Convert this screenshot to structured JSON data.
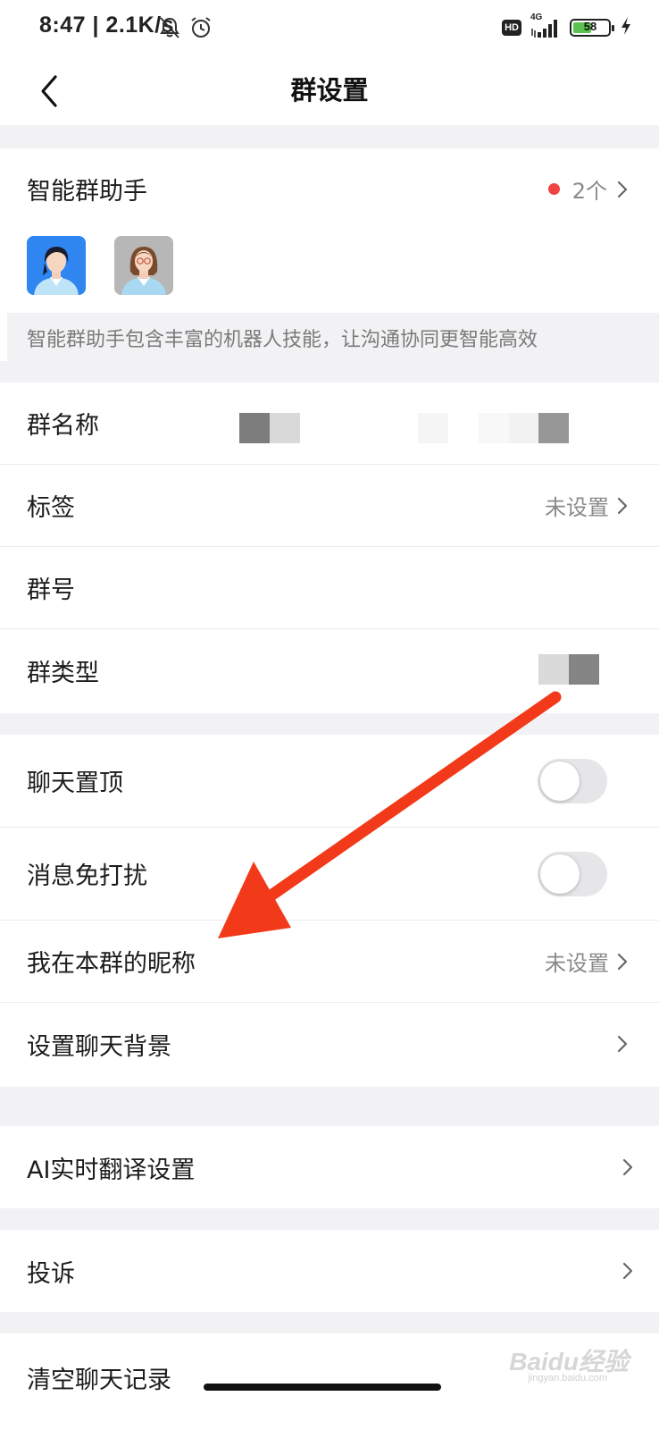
{
  "status_bar": {
    "time": "8:47 | 2.1K/s",
    "network_badge": "HD",
    "network_type": "4G",
    "battery_level": "58"
  },
  "nav": {
    "title": "群设置"
  },
  "assistant": {
    "title": "智能群助手",
    "count": "2个",
    "description": "智能群助手包含丰富的机器人技能，让沟通协同更智能高效"
  },
  "group_info": {
    "name_label": "群名称",
    "tag_label": "标签",
    "tag_value": "未设置",
    "number_label": "群号",
    "type_label": "群类型"
  },
  "chat_settings": {
    "pin_label": "聊天置顶",
    "mute_label": "消息免打扰",
    "nickname_label": "我在本群的昵称",
    "nickname_value": "未设置",
    "background_label": "设置聊天背景"
  },
  "translate": {
    "label": "AI实时翻译设置"
  },
  "report": {
    "label": "投诉"
  },
  "clear": {
    "label": "清空聊天记录"
  },
  "watermark": {
    "brand": "Baidu经验",
    "domain": "jingyan.baidu.com"
  },
  "colors": {
    "accent_red": "#f04343",
    "annotation_arrow": "#f23a1a",
    "page_bg": "#f2f2f4"
  }
}
